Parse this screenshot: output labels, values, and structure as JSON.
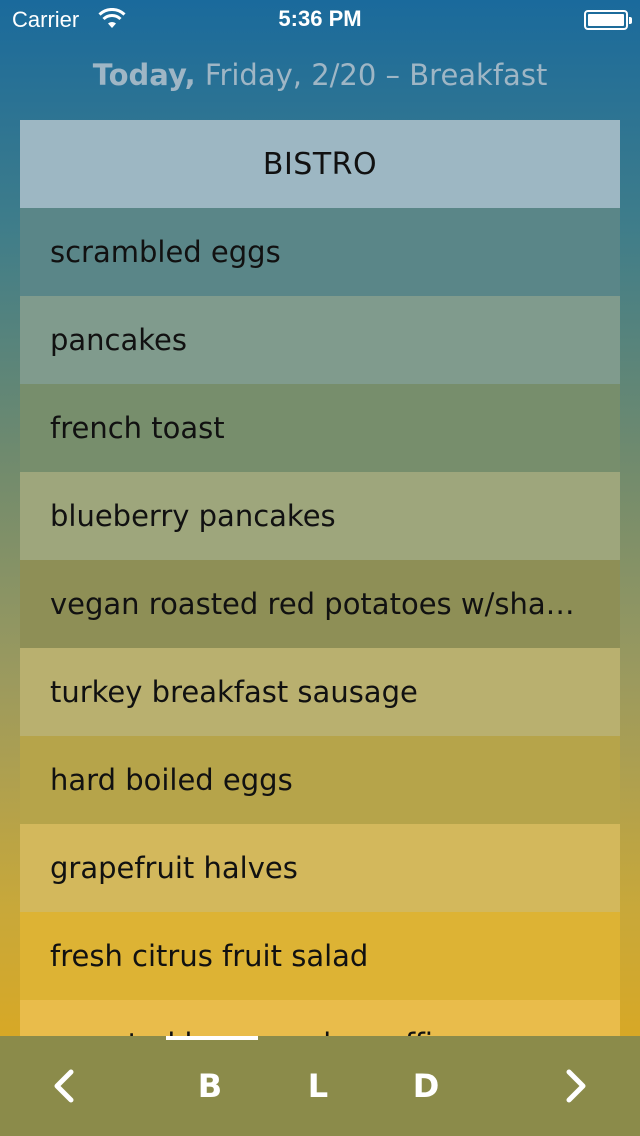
{
  "status_bar": {
    "carrier": "Carrier",
    "time": "5:36 PM"
  },
  "header": {
    "today": "Today,",
    "date_meal": "Friday, 2/20 – Breakfast"
  },
  "menu": {
    "title": "BISTRO",
    "items": [
      "scrambled eggs",
      "pancakes",
      "french toast",
      "blueberry pancakes",
      "vegan roasted red potatoes w/sha…",
      "turkey breakfast sausage",
      "hard boiled eggs",
      "grapefruit halves",
      "fresh citrus fruit salad",
      "assorted homemade muffins"
    ]
  },
  "toolbar": {
    "prev": "‹",
    "breakfast": "B",
    "lunch": "L",
    "dinner": "D",
    "next": "›",
    "selected": "B"
  },
  "colors": {
    "title_row": "#9db7c3",
    "rows": [
      "#5a8688",
      "#809b8d",
      "#778e6c",
      "#9ea67c",
      "#8e8f56",
      "#b9b06f",
      "#b6a44a",
      "#d3b85c",
      "#ddb334",
      "#e9bc4b"
    ],
    "toolbar": "#8b8b4a"
  },
  "icons": [
    "wifi-icon",
    "battery-icon",
    "chevron-left-icon",
    "chevron-right-icon"
  ]
}
